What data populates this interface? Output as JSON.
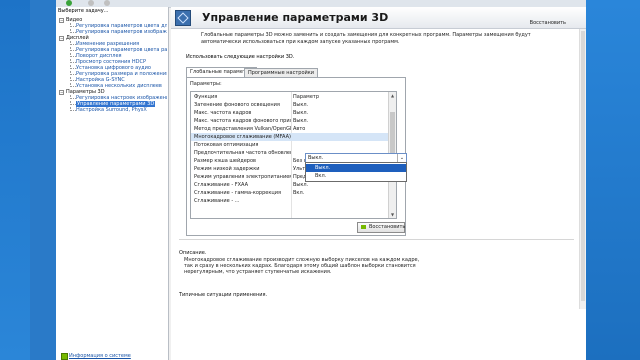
{
  "sidebar": {
    "title": "Выберите задачу...",
    "tree": [
      {
        "type": "cat",
        "label": "Видео"
      },
      {
        "type": "item",
        "label": "Регулировка параметров цвета для вид"
      },
      {
        "type": "item",
        "label": "Регулировка параметров изображения д"
      },
      {
        "type": "cat",
        "label": "Дисплей"
      },
      {
        "type": "item",
        "label": "Изменение разрешения"
      },
      {
        "type": "item",
        "label": "Регулировка параметров цвета рабочег"
      },
      {
        "type": "item",
        "label": "Поворот дисплея"
      },
      {
        "type": "item",
        "label": "Просмотр состояния HDCP"
      },
      {
        "type": "item",
        "label": "Установка цифрового аудио"
      },
      {
        "type": "item",
        "label": "Регулировка размера и положения рабо"
      },
      {
        "type": "item",
        "label": "Настройка G-SYNC"
      },
      {
        "type": "item",
        "label": "Установка нескольких дисплеев"
      },
      {
        "type": "cat",
        "label": "Параметры 3D"
      },
      {
        "type": "item",
        "label": "Регулировка настроек изображения с пр"
      },
      {
        "type": "item",
        "label": "Управление параметрами 3D",
        "selected": true
      },
      {
        "type": "item",
        "label": "Настройка Surround, PhysX"
      }
    ],
    "system_info_link": "Информация о системе"
  },
  "header": {
    "title": "Управление параметрами 3D",
    "restore_link": "Восстановить"
  },
  "main": {
    "description": "Глобальные параметры 3D можно заменить и создать замещения для конкретных программ. Параметры замещения будут автоматически использоваться при каждом запуске указанных программ.",
    "use_label": "Использовать следующие настройки 3D.",
    "tabs": [
      "Глобальные параметры",
      "Программные настройки"
    ],
    "params_label": "Параметры:",
    "columns": [
      "Функция",
      "Параметр"
    ],
    "rows": [
      [
        "Затенение фонового освещения",
        "Выкл."
      ],
      [
        "Макс. частота кадров",
        "Выкл."
      ],
      [
        "Макс. частота кадров фонового прило...",
        "Выкл."
      ],
      [
        "Метод представления Vulkan/OpenGL",
        "Авто"
      ],
      [
        "Многокадровое сглаживание (MFAA)",
        ""
      ],
      [
        "Потоковая оптимизация",
        ""
      ],
      [
        "Предпочтительная частота обновлени...",
        ""
      ],
      [
        "Размер кэша шейдеров",
        "Без ограничений"
      ],
      [
        "Режим низкой задержки",
        "Ультра"
      ],
      [
        "Режим управления электропитанием",
        "Предпочтителен режим максимальной п..."
      ],
      [
        "Сглаживание - FXAA",
        "Выкл."
      ],
      [
        "Сглаживание - гамма-коррекция",
        "Вкл."
      ],
      [
        "Сглаживание - ...",
        ""
      ]
    ],
    "dropdown": {
      "value": "Выкл.",
      "options": [
        "Выкл.",
        "Вкл."
      ]
    },
    "restore_button": "Восстановить",
    "description_label": "Описание.",
    "description_text": "Многокадровое сглаживание производит сложную выборку пикселов на каждом кадре, так и сразу в нескольких кадрах. Благодаря этому общий шаблон выборки становится нерегулярным, что устраняет ступенчатые искажения.",
    "typical_label": "Типичные ситуации применения."
  },
  "colors": {
    "accent": "#76b900",
    "selection": "#1e5fbd",
    "desktop": "#2a7ac8"
  }
}
